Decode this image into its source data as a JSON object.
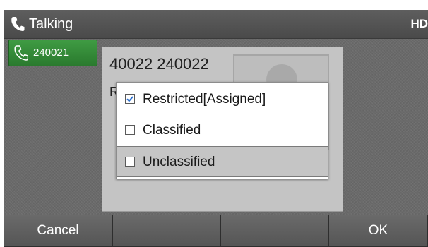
{
  "status_bar": {
    "title": "Talking",
    "badge": "HD"
  },
  "line_key": {
    "label": "240021"
  },
  "call": {
    "caller_number": "40022 240022",
    "hidden_label": "R"
  },
  "menu": {
    "items": [
      {
        "label": "Restricted[Assigned]",
        "checked": true
      },
      {
        "label": "Classified",
        "checked": false
      },
      {
        "label": "Unclassified",
        "checked": false
      }
    ],
    "selected_index": 2
  },
  "softkeys": [
    "Cancel",
    "",
    "",
    "OK"
  ],
  "colors": {
    "line_key_green": "#3f9b43",
    "checkmark_blue": "#2a6fd0",
    "highlight_gray": "#c5c5c5"
  },
  "icons": {
    "status": "phone-handset-icon",
    "line_key": "phone-handset-icon"
  }
}
